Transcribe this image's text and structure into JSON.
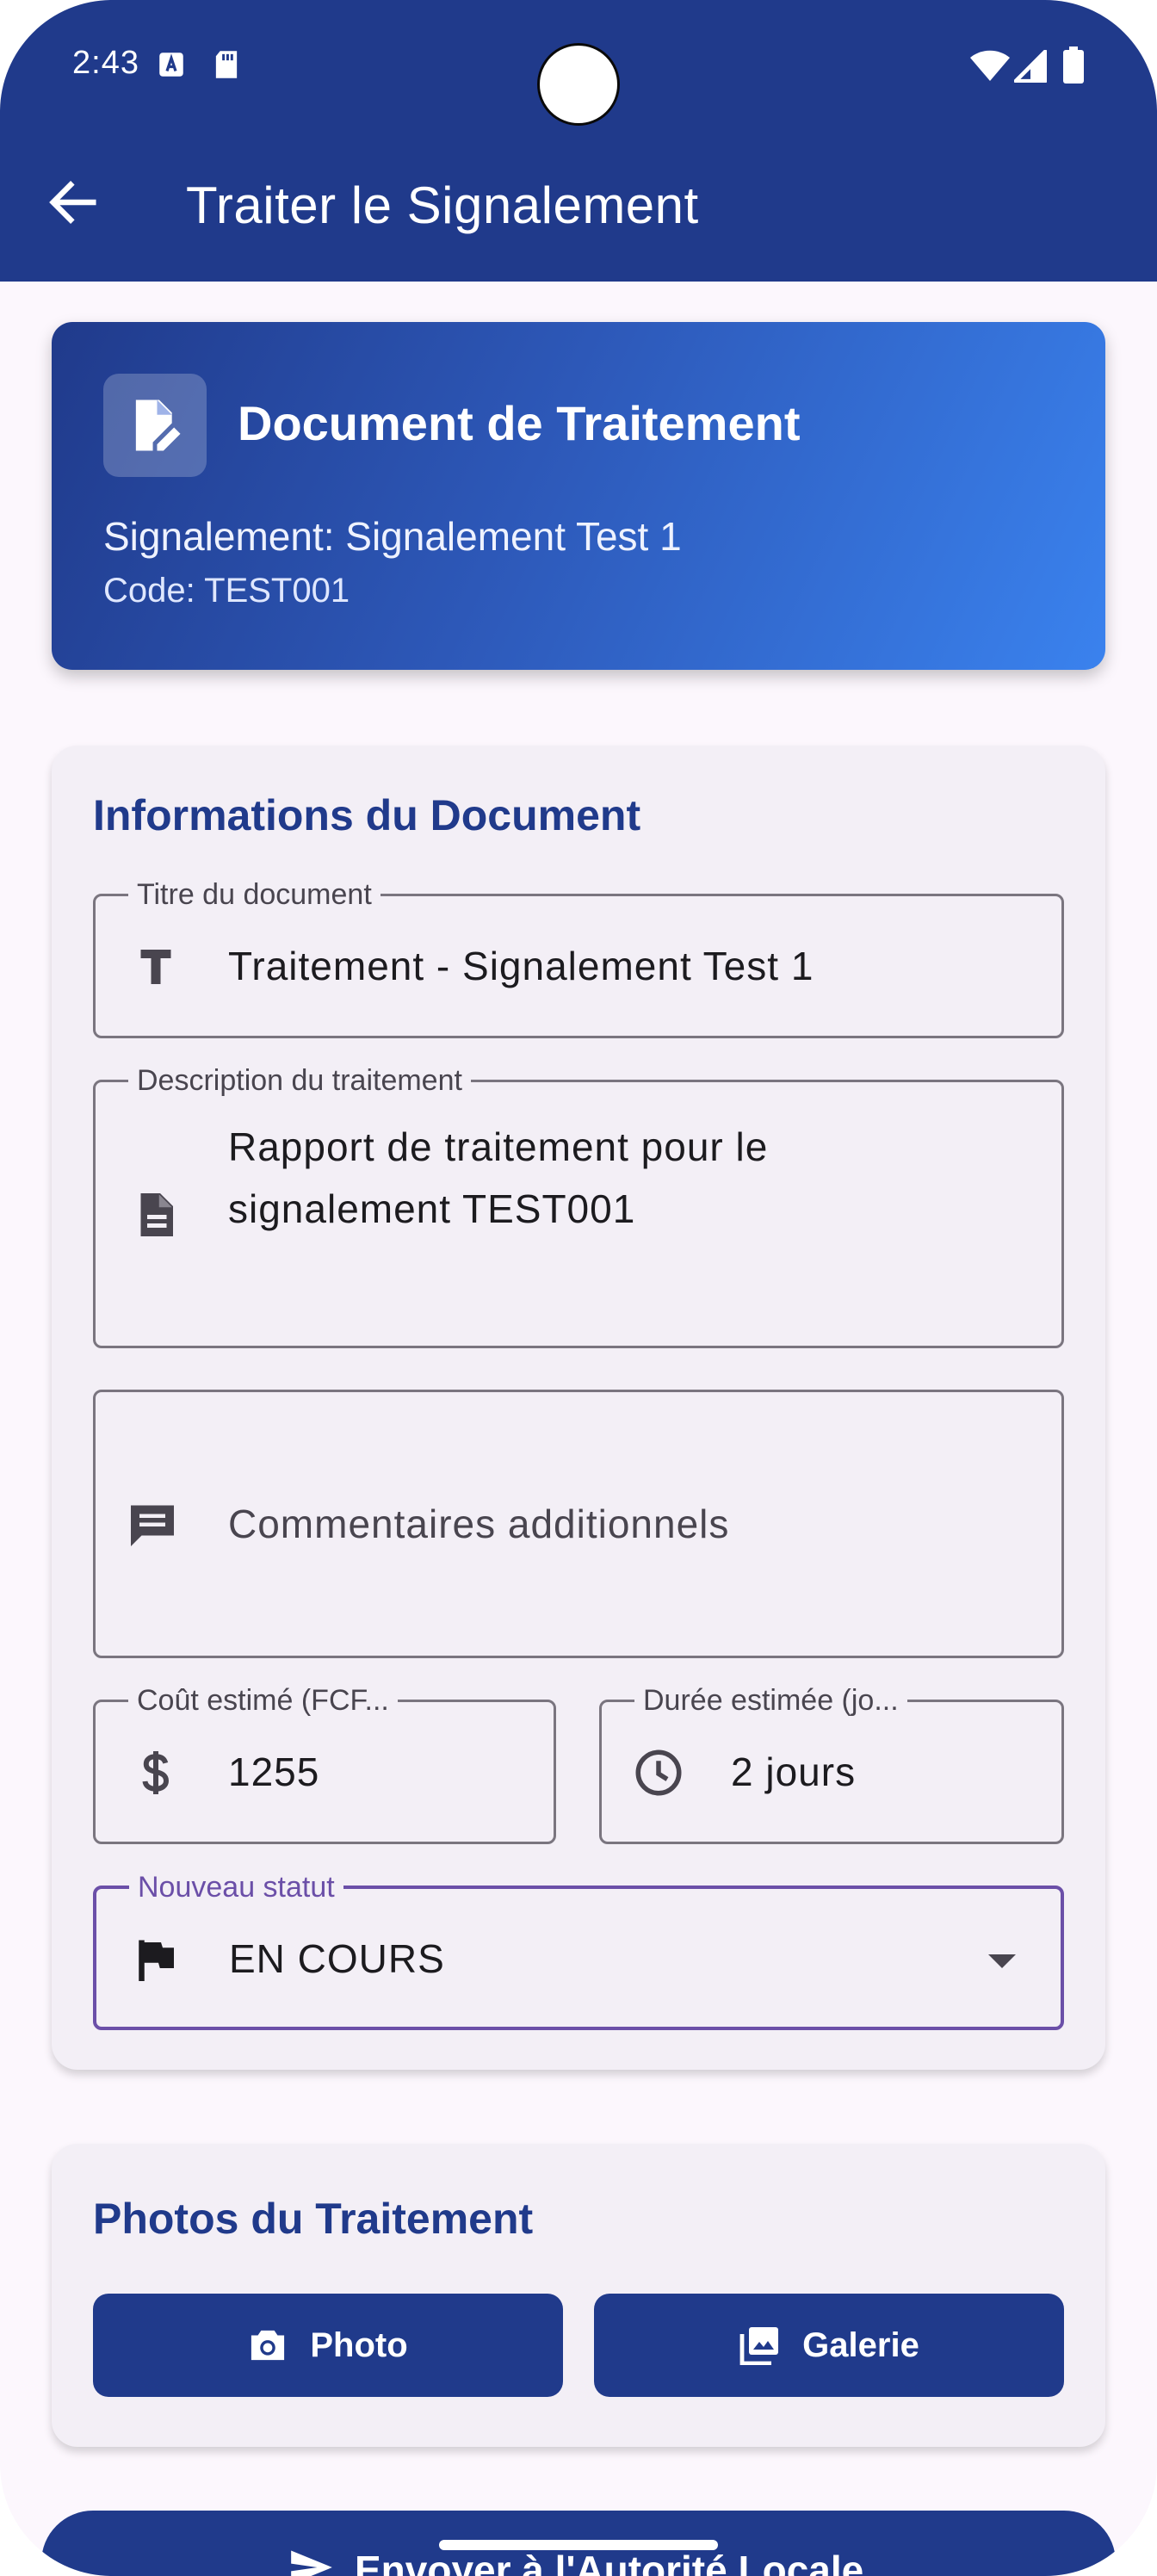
{
  "status_bar": {
    "time": "2:43",
    "left_icons": [
      "font-download-icon",
      "sd-card-icon"
    ],
    "right_icons": [
      "wifi-icon",
      "signal-icon",
      "battery-icon"
    ]
  },
  "appbar": {
    "back_icon": "arrow-back-icon",
    "title": "Traiter le Signalement",
    "color": "#203a8b"
  },
  "header_card": {
    "icon": "edit-document-icon",
    "title": "Document de Traitement",
    "signalement": "Signalement: Signalement Test 1",
    "code": "Code: TEST001"
  },
  "info_card": {
    "title": "Informations du Document",
    "titre": {
      "label": "Titre du document",
      "value": "Traitement - Signalement Test 1",
      "icon": "text-title-icon"
    },
    "description": {
      "label": "Description du traitement",
      "line1": "Rapport de traitement pour le",
      "line2": "signalement TEST001",
      "icon": "description-icon"
    },
    "commentaires": {
      "placeholder": "Commentaires additionnels",
      "icon": "comment-icon"
    },
    "cout": {
      "label": "Coût estimé (FCF...",
      "value": "1255",
      "icon": "dollar-icon"
    },
    "duree": {
      "label": "Durée estimée (jo...",
      "value": "2 jours",
      "icon": "clock-icon"
    },
    "statut": {
      "label": "Nouveau statut",
      "value": "EN COURS",
      "icon": "flag-icon",
      "accent": "#6b4fa8"
    }
  },
  "photos_card": {
    "title": "Photos du Traitement",
    "photo_button": "Photo",
    "gallery_button": "Galerie"
  },
  "submit": {
    "label": "Envoyer à l'Autorité Locale",
    "icon": "send-icon"
  }
}
